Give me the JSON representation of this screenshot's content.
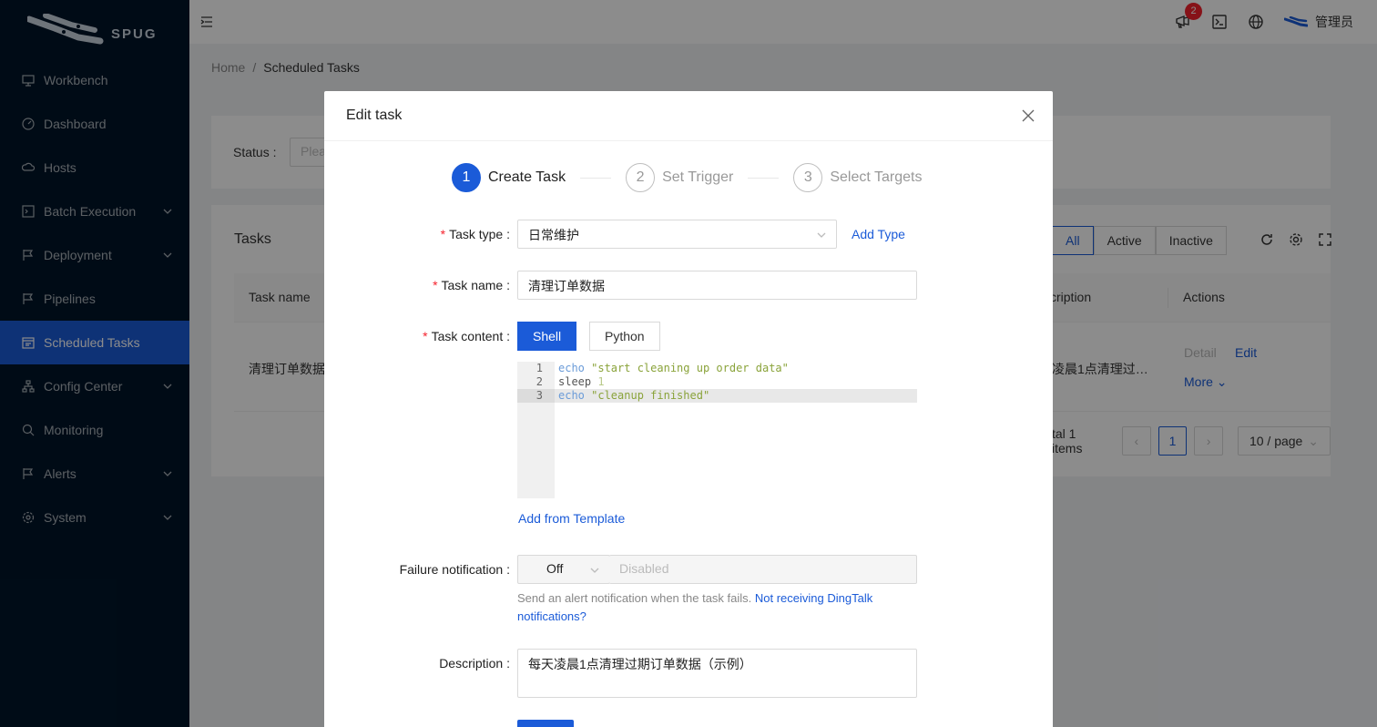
{
  "app": {
    "logo_text": "SPUG"
  },
  "sidebar": {
    "items": [
      {
        "label": "Workbench",
        "icon": "desktop-icon",
        "has_children": false
      },
      {
        "label": "Dashboard",
        "icon": "dashboard-icon",
        "has_children": false
      },
      {
        "label": "Hosts",
        "icon": "cloud-server-icon",
        "has_children": false
      },
      {
        "label": "Batch Execution",
        "icon": "code-icon",
        "has_children": true
      },
      {
        "label": "Deployment",
        "icon": "flag-icon",
        "has_children": true
      },
      {
        "label": "Pipelines",
        "icon": "flag-icon",
        "has_children": false
      },
      {
        "label": "Scheduled Tasks",
        "icon": "schedule-icon",
        "has_children": false,
        "active": true
      },
      {
        "label": "Config Center",
        "icon": "apartment-icon",
        "has_children": true
      },
      {
        "label": "Monitoring",
        "icon": "monitor-icon",
        "has_children": false
      },
      {
        "label": "Alerts",
        "icon": "alert-icon",
        "has_children": true
      },
      {
        "label": "System",
        "icon": "setting-icon",
        "has_children": true
      }
    ]
  },
  "header": {
    "notification_count": "2",
    "user_name": "管理员"
  },
  "breadcrumb": {
    "home": "Home",
    "current": "Scheduled Tasks"
  },
  "filter": {
    "status_label": "Status",
    "status_placeholder": "Plea"
  },
  "tasks": {
    "title": "Tasks",
    "segments": [
      "All",
      "Active",
      "Inactive"
    ],
    "columns": [
      "Task name",
      "cription",
      "Actions"
    ],
    "row": {
      "name": "清理订单数据",
      "description": "凌晨1点清理过…",
      "actions": [
        "Detail",
        "Edit",
        "More"
      ]
    },
    "pagination": {
      "total": "tal 1 items",
      "page": "1",
      "page_size": "10 / page"
    }
  },
  "modal": {
    "title": "Edit task",
    "steps": [
      {
        "num": "1",
        "title": "Create Task"
      },
      {
        "num": "2",
        "title": "Set Trigger"
      },
      {
        "num": "3",
        "title": "Select Targets"
      }
    ],
    "task_type": {
      "label": "Task type",
      "value": "日常维护",
      "add_link": "Add Type"
    },
    "task_name": {
      "label": "Task name",
      "value": "清理订单数据"
    },
    "task_content": {
      "label": "Task content",
      "tabs": [
        "Shell",
        "Python"
      ],
      "code": [
        {
          "n": "1",
          "kw": "echo",
          "rest": " \"start cleaning up order data\""
        },
        {
          "n": "2",
          "kw": "sleep",
          "rest": " 1"
        },
        {
          "n": "3",
          "kw": "echo",
          "rest": " \"cleanup finished\""
        }
      ],
      "template_link": "Add from Template"
    },
    "failure": {
      "label": "Failure notification",
      "mode": "Off",
      "placeholder": "Disabled",
      "hint": "Send an alert notification when the task fails.",
      "hint_link": "Not receiving DingTalk notifications?"
    },
    "description": {
      "label": "Description",
      "value": "每天凌晨1点清理过期订单数据（示例）"
    }
  },
  "colors": {
    "accent": "#1b5bd8",
    "sidebar_bg": "#001529",
    "required": "#f5222d"
  }
}
